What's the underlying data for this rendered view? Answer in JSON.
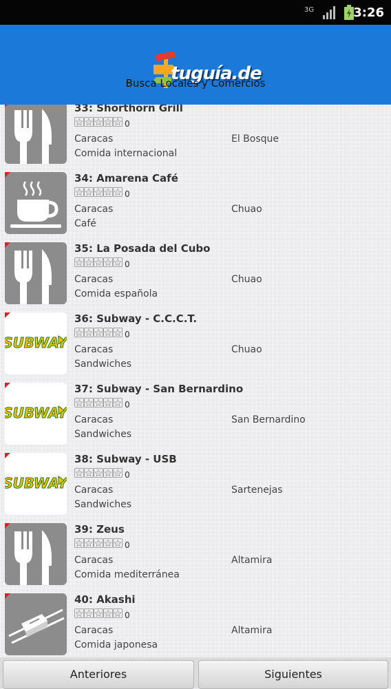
{
  "status_bar": {
    "network": "3G",
    "time": "3:26"
  },
  "header": {
    "logo_text": "tuguía.de",
    "subtitle": "Busca Locales y Comercios"
  },
  "listings": [
    {
      "name": "33: Shorthorn Grill",
      "rating": "0",
      "city": "Caracas",
      "zone": "El Bosque",
      "category": "Comida internacional",
      "icon": "fork-knife-icon"
    },
    {
      "name": "34: Amarena Café",
      "rating": "0",
      "city": "Caracas",
      "zone": "Chuao",
      "category": "Café",
      "icon": "coffee-cup-icon"
    },
    {
      "name": "35: La Posada del Cubo",
      "rating": "0",
      "city": "Caracas",
      "zone": "Chuao",
      "category": "Comida española",
      "icon": "fork-knife-icon"
    },
    {
      "name": "36: Subway - C.C.C.T.",
      "rating": "0",
      "city": "Caracas",
      "zone": "Chuao",
      "category": "Sandwiches",
      "icon": "subway-logo",
      "logo_text": "SUBWAY"
    },
    {
      "name": "37: Subway - San Bernardino",
      "rating": "0",
      "city": "Caracas",
      "zone": "San Bernardino",
      "category": "Sandwiches",
      "icon": "subway-logo",
      "logo_text": "SUBWAY"
    },
    {
      "name": "38: Subway - USB",
      "rating": "0",
      "city": "Caracas",
      "zone": "Sartenejas",
      "category": "Sandwiches",
      "icon": "subway-logo",
      "logo_text": "SUBWAY"
    },
    {
      "name": "39: Zeus",
      "rating": "0",
      "city": "Caracas",
      "zone": "Altamira",
      "category": "Comida mediterránea",
      "icon": "fork-knife-icon"
    },
    {
      "name": "40: Akashi",
      "rating": "0",
      "city": "Caracas",
      "zone": "Altamira",
      "category": "Comida japonesa",
      "icon": "sushi-icon"
    }
  ],
  "pagination": {
    "prev_label": "Anteriores",
    "next_label": "Siguientes"
  },
  "colors": {
    "app_bar": "#1b7ad9",
    "status_bar": "#050505",
    "background": "#ecebee",
    "accent_red": "#e02020",
    "subway_green": "#1e7a1e",
    "subway_yellow": "#f2c300"
  }
}
